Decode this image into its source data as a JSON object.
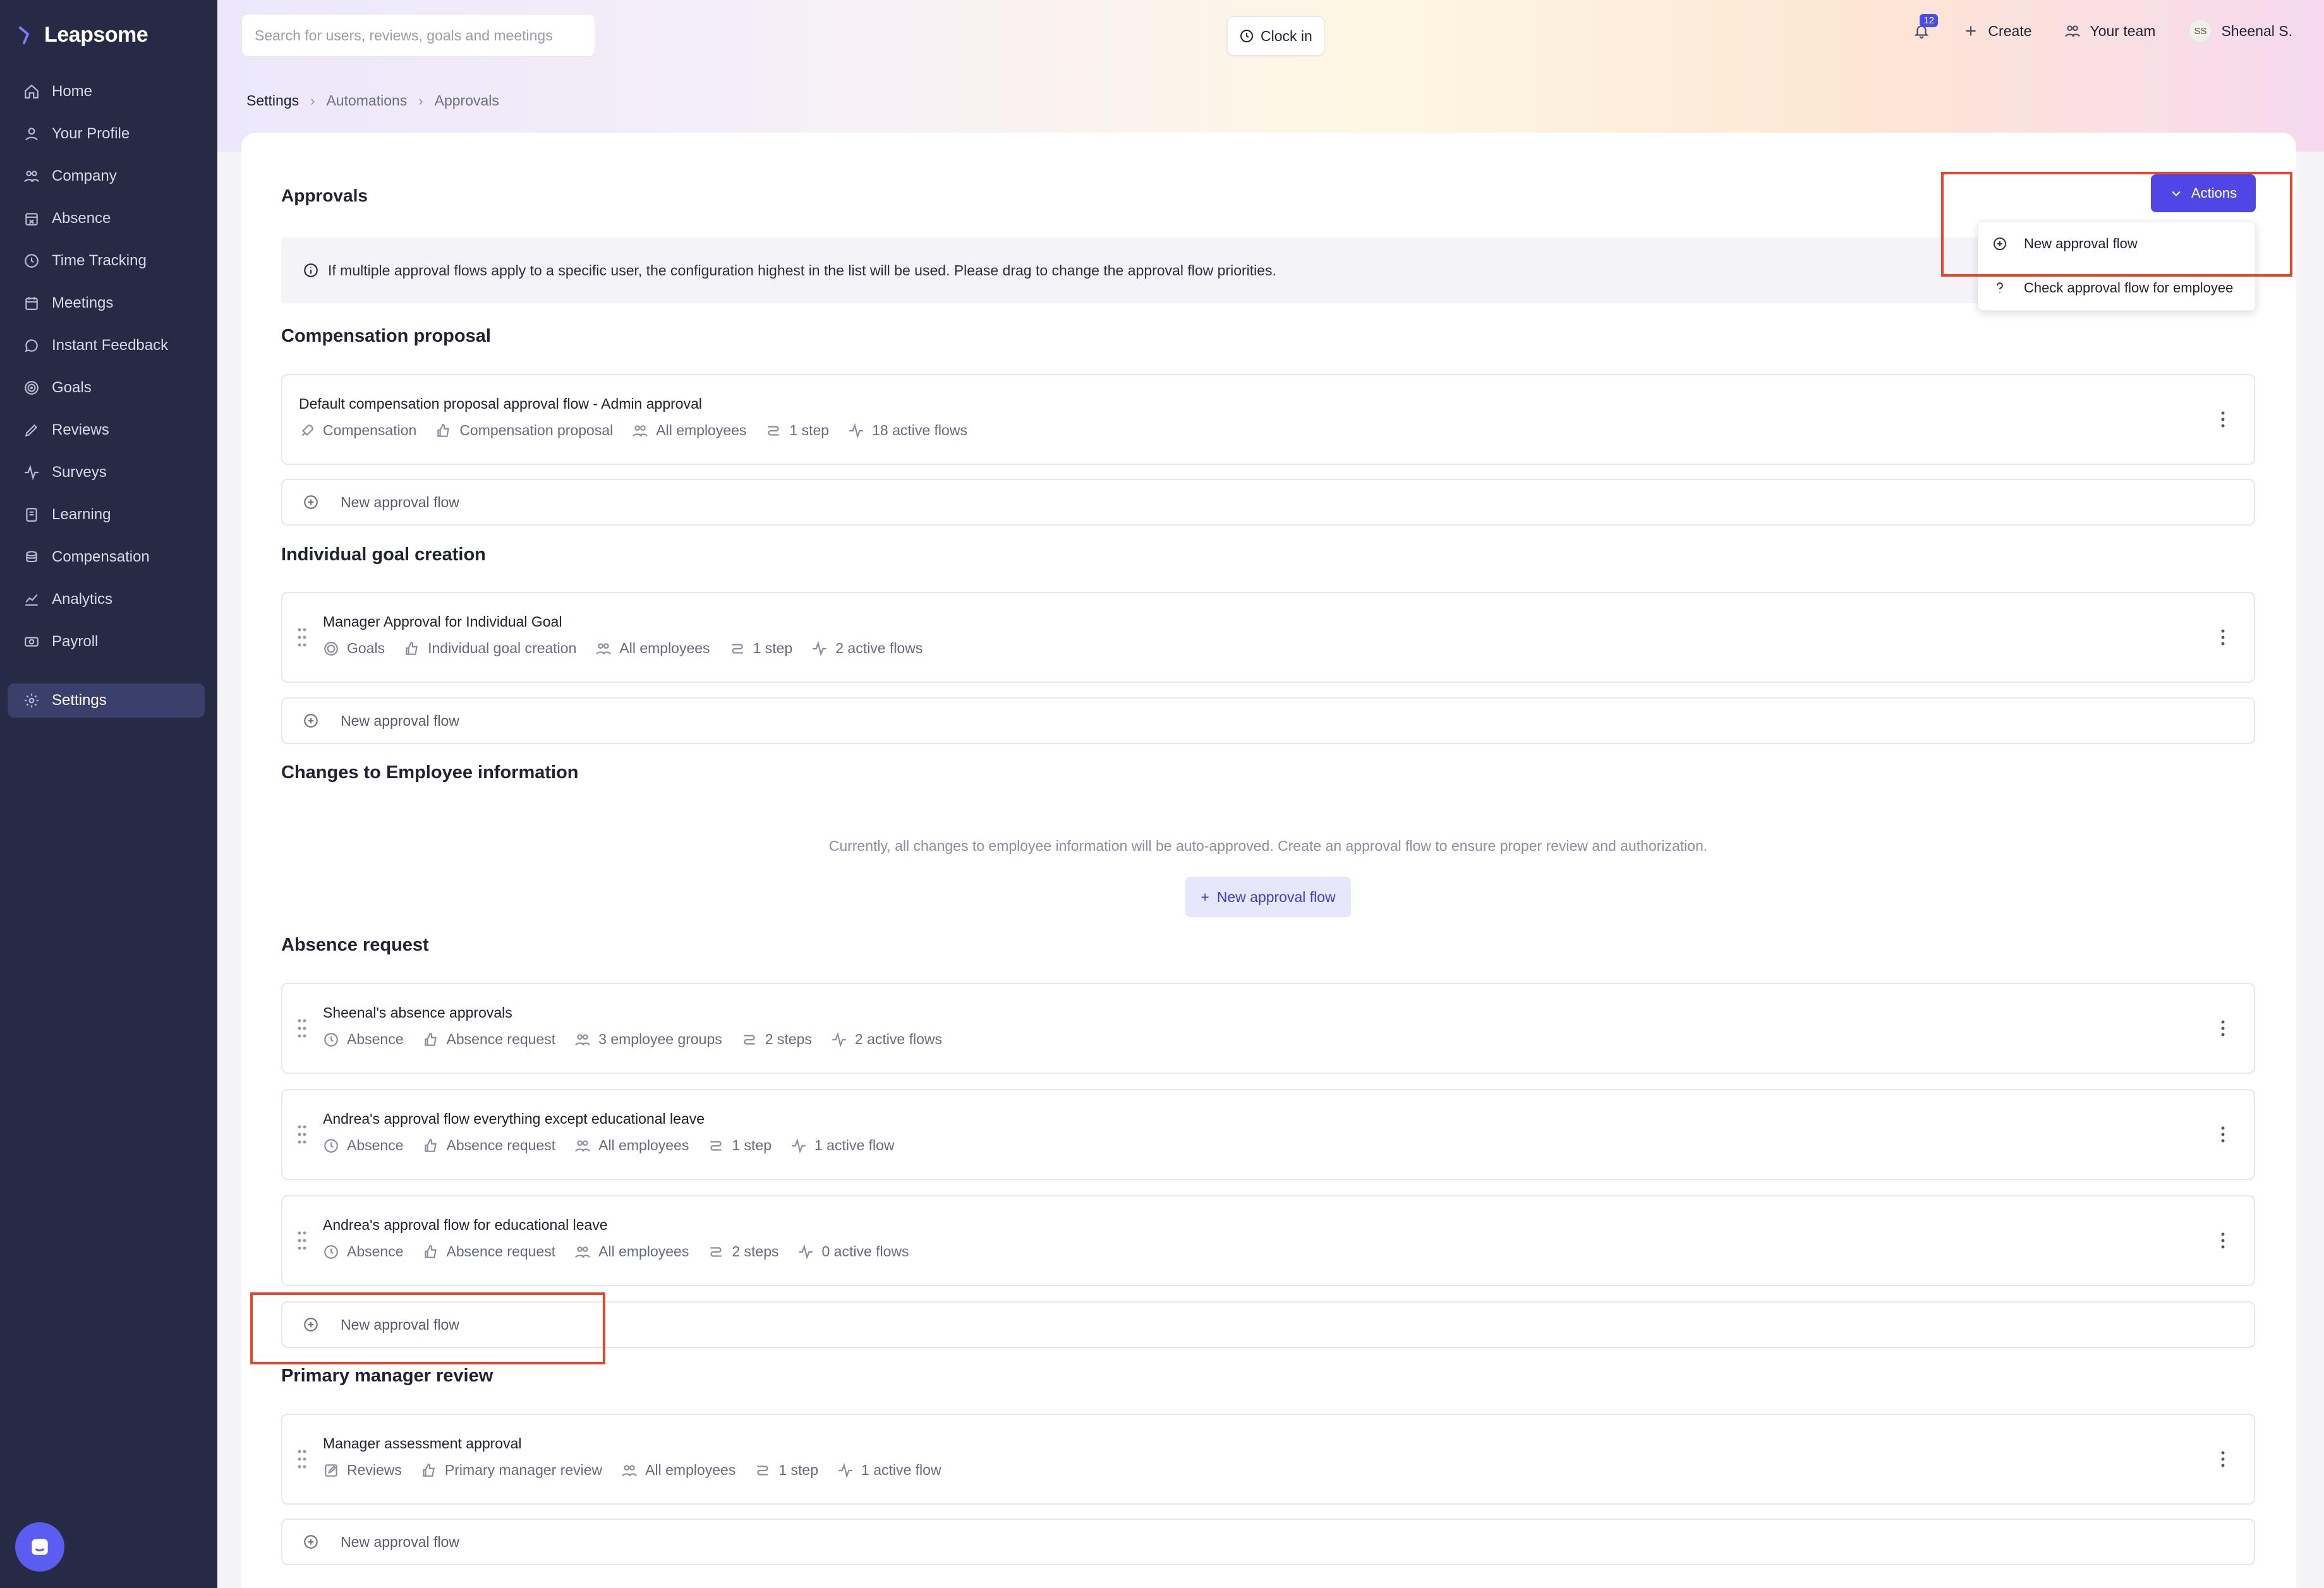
{
  "app": {
    "logo": "Leapsome"
  },
  "sidebar": {
    "items": [
      {
        "label": "Home",
        "icon": "home-icon"
      },
      {
        "label": "Your Profile",
        "icon": "user-icon"
      },
      {
        "label": "Company",
        "icon": "people-icon"
      },
      {
        "label": "Absence",
        "icon": "calendar-x-icon"
      },
      {
        "label": "Time Tracking",
        "icon": "clock-icon"
      },
      {
        "label": "Meetings",
        "icon": "calendar-icon"
      },
      {
        "label": "Instant Feedback",
        "icon": "chat-icon"
      },
      {
        "label": "Goals",
        "icon": "target-icon"
      },
      {
        "label": "Reviews",
        "icon": "pen-icon"
      },
      {
        "label": "Surveys",
        "icon": "pulse-icon"
      },
      {
        "label": "Learning",
        "icon": "book-icon"
      },
      {
        "label": "Compensation",
        "icon": "coins-icon"
      },
      {
        "label": "Analytics",
        "icon": "chart-icon"
      },
      {
        "label": "Payroll",
        "icon": "cash-icon"
      },
      {
        "label": "Settings",
        "icon": "gear-icon",
        "active": true
      }
    ]
  },
  "header": {
    "search_placeholder": "Search for users, reviews, goals and meetings",
    "clock_in": "Clock in",
    "notifications_count": "12",
    "create": "Create",
    "your_team": "Your team",
    "avatar_initials": "SS",
    "user_name": "Sheenal S."
  },
  "breadcrumb": [
    "Settings",
    "Automations",
    "Approvals"
  ],
  "page": {
    "title": "Approvals",
    "actions_label": "Actions",
    "info": "If multiple approval flows apply to a specific user, the configuration highest in the list will be used. Please drag to change the approval flow priorities.",
    "dropdown": [
      "New approval flow",
      "Check approval flow for employee"
    ],
    "new_flow_label": "New approval flow"
  },
  "sections": {
    "compensation": {
      "title": "Compensation proposal",
      "flows": [
        {
          "name": "Default compensation proposal approval flow - Admin approval",
          "module": "Compensation",
          "type": "Compensation proposal",
          "audience": "All employees",
          "steps": "1 step",
          "active": "18 active flows"
        }
      ]
    },
    "goal": {
      "title": "Individual goal creation",
      "flows": [
        {
          "name": "Manager Approval for Individual Goal",
          "module": "Goals",
          "type": "Individual goal creation",
          "audience": "All employees",
          "steps": "1 step",
          "active": "2 active flows"
        }
      ]
    },
    "employee_info": {
      "title": "Changes to Employee information",
      "empty_text": "Currently, all changes to employee information will be auto-approved. Create an approval flow to ensure proper review and authorization.",
      "button": "New approval flow"
    },
    "absence": {
      "title": "Absence request",
      "flows": [
        {
          "name": "Sheenal's absence approvals",
          "module": "Absence",
          "type": "Absence request",
          "audience": "3 employee groups",
          "steps": "2 steps",
          "active": "2 active flows"
        },
        {
          "name": "Andrea's approval flow everything except educational leave",
          "module": "Absence",
          "type": "Absence request",
          "audience": "All employees",
          "steps": "1 step",
          "active": "1 active flow"
        },
        {
          "name": "Andrea's approval flow for educational leave",
          "module": "Absence",
          "type": "Absence request",
          "audience": "All employees",
          "steps": "2 steps",
          "active": "0 active flows"
        }
      ]
    },
    "review": {
      "title": "Primary manager review",
      "flows": [
        {
          "name": "Manager assessment approval",
          "module": "Reviews",
          "type": "Primary manager review",
          "audience": "All employees",
          "steps": "1 step",
          "active": "1 active flow"
        }
      ]
    }
  },
  "colors": {
    "sidebar": "#262a45",
    "accent": "#4f46e5",
    "highlight": "#e8452c"
  }
}
